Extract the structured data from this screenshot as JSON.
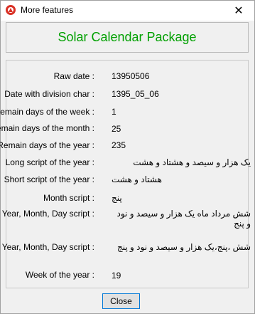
{
  "window": {
    "title": "More features",
    "close_glyph": "✕"
  },
  "header": {
    "title": "Solar Calendar Package",
    "title_color": "#00a000"
  },
  "rows": [
    {
      "label": "Raw date :",
      "value": "13950506"
    },
    {
      "label": "Date with division char :",
      "value": "1395_05_06"
    },
    {
      "label": "Remain days of the week :",
      "value": "1"
    },
    {
      "label": "Remain days of the month :",
      "value": "25"
    },
    {
      "label": "Remain days of the year :",
      "value": "235"
    },
    {
      "label": "Long script of the year :",
      "value": "یک هزار و سیصد و هشتاد و هشت"
    },
    {
      "label": "Short script of the year :",
      "value": "هشتاد و هشت"
    },
    {
      "label": "Month script :",
      "value": "پنج"
    },
    {
      "label": "Year, Month, Day script :",
      "value": "شش مرداد ماه یک هزار و سیصد و نود و پنج"
    },
    {
      "label": "Year, Month, Day script :",
      "value": "شش ،پنج،یک هزار و سیصد و نود و پنج"
    },
    {
      "label": "Week of the year :",
      "value": "19"
    }
  ],
  "footer": {
    "close_label": "Close"
  },
  "icons": {
    "app_icon": "app-icon",
    "window_close": "close-icon"
  }
}
